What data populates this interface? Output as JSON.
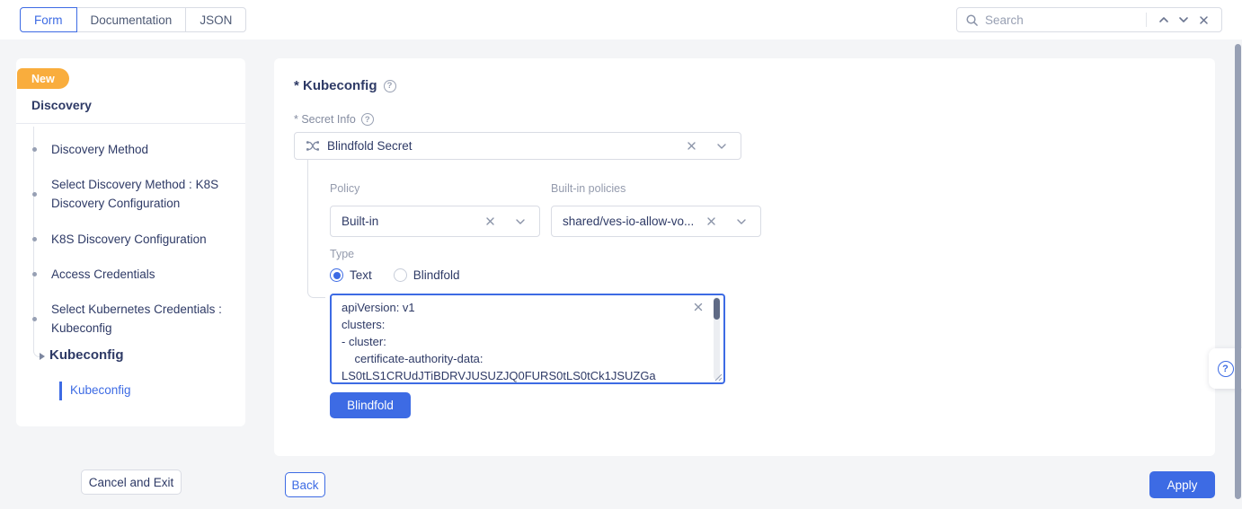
{
  "colors": {
    "accent_blue": "#3d6be4",
    "badge_orange": "#f9ad3d",
    "text_navy": "#2e3a66",
    "label_gray": "#949bad",
    "border_gray": "#d9dce4"
  },
  "icons": {
    "info_glyph": "?",
    "help_glyph": "?"
  },
  "topbar": {
    "tabs": [
      {
        "label": "Form",
        "active": true
      },
      {
        "label": "Documentation",
        "active": false
      },
      {
        "label": "JSON",
        "active": false
      }
    ],
    "search": {
      "placeholder": "Search"
    }
  },
  "sidebar": {
    "badge": "New",
    "section_title": "Discovery",
    "steps": [
      "Discovery Method",
      "Select Discovery Method : K8S Discovery Configuration",
      "K8S Discovery Configuration",
      "Access Credentials",
      "Select Kubernetes Credentials : Kubeconfig"
    ],
    "expanded_item": "Kubeconfig",
    "active_subitem": "Kubeconfig",
    "cancel_exit_label": "Cancel and Exit"
  },
  "main": {
    "title": "* Kubeconfig",
    "secret_info": {
      "label": "* Secret Info",
      "selected_value": "Blindfold Secret"
    },
    "policy": {
      "label": "Policy",
      "selected_value": "Built-in"
    },
    "builtin_policies": {
      "label": "Built-in policies",
      "selected_value": "shared/ves-io-allow-vo..."
    },
    "type": {
      "label": "Type",
      "options": [
        {
          "label": "Text",
          "selected": true
        },
        {
          "label": "Blindfold",
          "selected": false
        }
      ]
    },
    "kubeconfig_value": "apiVersion: v1\nclusters:\n- cluster:\n    certificate-authority-data:\nLS0tLS1CRUdJTiBDRVJUSUZJQ0FURS0tLS0tCk1JSUZGa",
    "blindfold_button_label": "Blindfold",
    "back_button_label": "Back",
    "apply_button_label": "Apply"
  }
}
